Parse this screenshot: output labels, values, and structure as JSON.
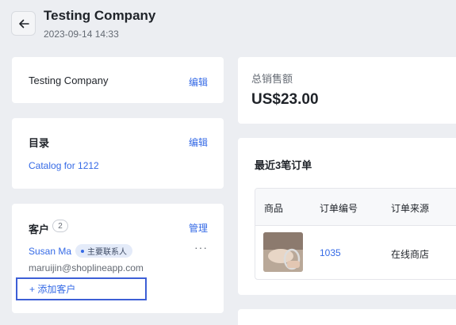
{
  "header": {
    "title": "Testing Company",
    "datetime": "2023-09-14 14:33"
  },
  "company_card": {
    "name": "Testing Company",
    "edit_label": "编辑"
  },
  "catalog_card": {
    "title": "目录",
    "edit_label": "编辑",
    "catalog_link": "Catalog for 1212"
  },
  "customer_card": {
    "title": "客户",
    "count": "2",
    "manage_label": "管理",
    "customer_name": "Susan Ma",
    "primary_tag": "主要联系人",
    "more_label": "···",
    "customer_email": "maruijin@shoplineapp.com",
    "add_label": "+ 添加客户"
  },
  "sales_card": {
    "label": "总销售额",
    "amount": "US$23.00"
  },
  "orders_card": {
    "title": "最近3笔订单",
    "columns": [
      "商品",
      "订单编号",
      "订单来源"
    ],
    "rows": [
      {
        "order_no": "1035",
        "source": "在线商店"
      }
    ]
  },
  "colors": {
    "accent": "#356ae6",
    "background": "#eceef2"
  },
  "icons": {
    "back": "arrow-left-icon"
  }
}
